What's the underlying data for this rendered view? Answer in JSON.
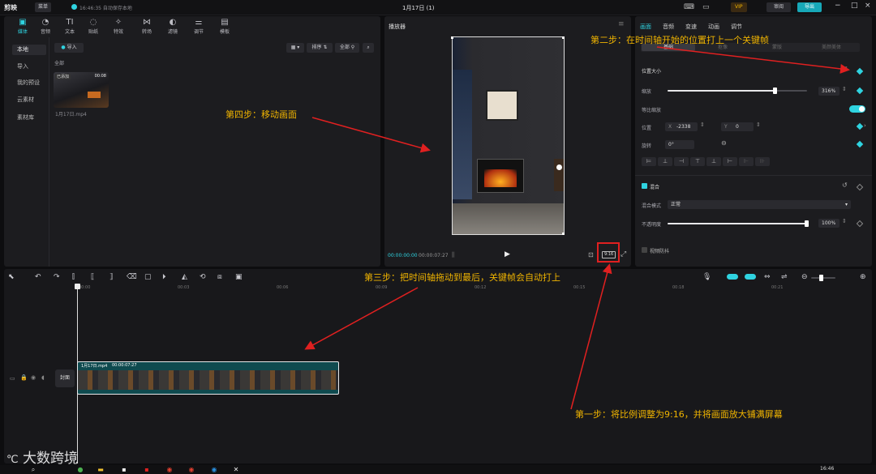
{
  "app": {
    "title": "1月17日 (1)",
    "logo": "剪映",
    "draft_menu": "菜单",
    "autosave": "16:46:35 自动保存本地",
    "pro_badge": "VIP",
    "review_label": "审阅",
    "export_label": "导出"
  },
  "toolbar": {
    "items": [
      {
        "label": "媒体",
        "glyph": "▣"
      },
      {
        "label": "音频",
        "glyph": "◔"
      },
      {
        "label": "文本",
        "glyph": "TI"
      },
      {
        "label": "贴纸",
        "glyph": "◌"
      },
      {
        "label": "特效",
        "glyph": "✧"
      },
      {
        "label": "转场",
        "glyph": "⋈"
      },
      {
        "label": "滤镜",
        "glyph": "◐"
      },
      {
        "label": "调节",
        "glyph": "⚌"
      },
      {
        "label": "模板",
        "glyph": "▤"
      }
    ]
  },
  "media": {
    "side": [
      "本地",
      "导入",
      "我的预设",
      "云素材",
      "素材库"
    ],
    "import_label": "导入",
    "all_label": "全部",
    "sort_label": "排序",
    "filter_label": "全部",
    "clip_badge": "已添加",
    "clip_duration": "00:08",
    "clip_name": "1月17日.mp4"
  },
  "player": {
    "title": "播放器",
    "current_time": "00:00:00:00",
    "total_time": "00:00:07:27",
    "ratio": "9:16"
  },
  "props": {
    "tabs": [
      "画面",
      "音频",
      "变速",
      "动画",
      "调节"
    ],
    "subtabs": [
      "基础",
      "抠像",
      "蒙版",
      "美颜美体"
    ],
    "section_position": "位置大小",
    "scale_label": "缩放",
    "scale_value": "316%",
    "scale_fraction": 0.77,
    "uniform_label": "等比缩放",
    "pos_label": "位置",
    "x_label": "X",
    "x_value": "-2338",
    "y_label": "Y",
    "y_value": "0",
    "rotate_label": "旋转",
    "rotate_value": "0°",
    "blend_label": "混合",
    "blend_mode_label": "混合模式",
    "blend_mode_value": "正常",
    "opacity_label": "不透明度",
    "opacity_value": "100%",
    "opacity_fraction": 1.0,
    "stabilize_label": "视频防抖"
  },
  "timeline": {
    "ticks": [
      "00:00",
      "00:03",
      "00:06",
      "00:09",
      "00:12",
      "00:15",
      "00:18",
      "00:21"
    ],
    "cover_label": "封面",
    "clip_label": "1月17日.mp4",
    "clip_duration": "00:00:07:27"
  },
  "annotations": {
    "step1": "第一步：将比例调整为9:16，并将画面放大铺满屏幕",
    "step2": "第二步：在时间轴开始的位置打上一个关键帧",
    "step3": "第三步：把时间轴拖动到最后，关键帧会自动打上",
    "step4": "第四步：移动画面"
  },
  "watermark": "大数跨境",
  "taskbar": {
    "time": "16:46"
  }
}
